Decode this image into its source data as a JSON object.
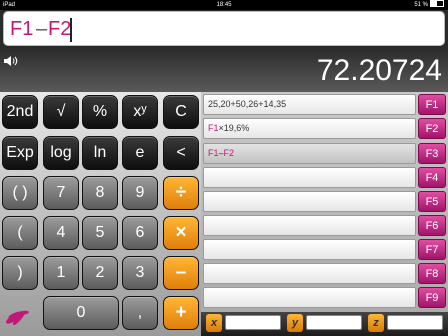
{
  "status": {
    "device": "iPad",
    "time": "18:45",
    "battery": "51 %"
  },
  "expression": {
    "part1": "F1",
    "operator": "–",
    "part2": "F2"
  },
  "result": "72.20724",
  "keys": [
    {
      "label": "2nd"
    },
    {
      "label": "√"
    },
    {
      "label": "%"
    },
    {
      "label": "xʸ"
    },
    {
      "label": "C"
    },
    {
      "label": "Exp"
    },
    {
      "label": "log"
    },
    {
      "label": "ln"
    },
    {
      "label": "e"
    },
    {
      "label": "<"
    },
    {
      "label": "( )"
    },
    {
      "label": "7"
    },
    {
      "label": "8"
    },
    {
      "label": "9"
    },
    {
      "label": "÷"
    },
    {
      "label": "("
    },
    {
      "label": "4"
    },
    {
      "label": "5"
    },
    {
      "label": "6"
    },
    {
      "label": "×"
    },
    {
      "label": ")"
    },
    {
      "label": "1"
    },
    {
      "label": "2"
    },
    {
      "label": "3"
    },
    {
      "label": "–"
    },
    {
      "label": "0"
    },
    {
      "label": ","
    },
    {
      "label": "+"
    }
  ],
  "functions": {
    "f1": {
      "text": "25,20+50,26+14,35",
      "button": "F1"
    },
    "f2": {
      "ref": "F1",
      "text": "×19,6%",
      "button": "F2"
    },
    "f3": {
      "ref1": "F1",
      "op": "–",
      "ref2": "F2",
      "button": "F3"
    },
    "f4": {
      "button": "F4"
    },
    "f5": {
      "button": "F5"
    },
    "f6": {
      "button": "F6"
    },
    "f7": {
      "button": "F7"
    },
    "f8": {
      "button": "F8"
    },
    "f9": {
      "button": "F9"
    }
  },
  "variables": {
    "x": "x",
    "y": "y",
    "z": "z"
  },
  "colors": {
    "accent": "#c2187c",
    "operator_key": "#f39a1a",
    "function_button": "#c0267e"
  }
}
